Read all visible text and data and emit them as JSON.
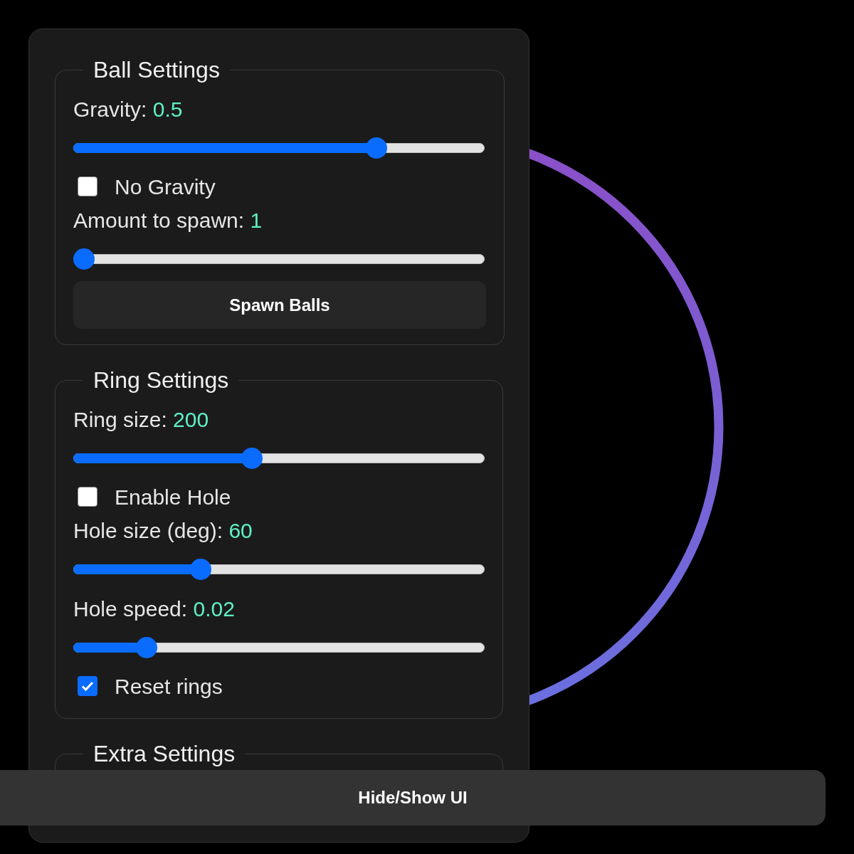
{
  "sections": [
    {
      "legend": "Ball Settings",
      "items": [
        {
          "kind": "slider",
          "label": "Gravity:",
          "value": "0.5",
          "level": 0.75
        },
        {
          "kind": "checkbox",
          "label": "No Gravity",
          "checked": false
        },
        {
          "kind": "slider",
          "label": "Amount to spawn:",
          "value": "1",
          "level": 0
        },
        {
          "kind": "button",
          "label": "Spawn Balls"
        }
      ]
    },
    {
      "legend": "Ring Settings",
      "items": [
        {
          "kind": "slider",
          "label": "Ring size:",
          "value": "200",
          "level": 0.43
        },
        {
          "kind": "checkbox",
          "label": "Enable Hole",
          "checked": false
        },
        {
          "kind": "slider",
          "label": "Hole size (deg):",
          "value": "60",
          "level": 0.3
        },
        {
          "kind": "slider",
          "label": "Hole speed:",
          "value": "0.02",
          "level": 0.16
        },
        {
          "kind": "checkbox",
          "label": "Reset rings",
          "checked": true
        }
      ]
    },
    {
      "legend": "Extra Settings"
    }
  ],
  "toggle_button": "Hide/Show UI"
}
